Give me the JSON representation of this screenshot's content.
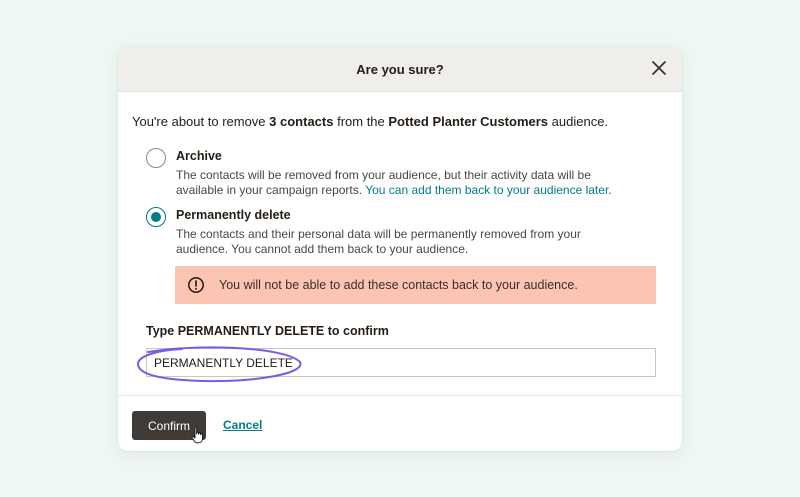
{
  "modal": {
    "title": "Are you sure?",
    "close_icon": "close-icon"
  },
  "intro": {
    "prefix": "You're about to remove ",
    "count": "3 contacts",
    "middle": " from the ",
    "audience": "Potted Planter Customers",
    "suffix": " audience."
  },
  "options": {
    "archive": {
      "title": "Archive",
      "desc_line1": "The contacts will be removed from your audience, but their activity data will be",
      "desc_line2_prefix": "available in your campaign reports. ",
      "desc_line2_link": "You can add them back to your audience later",
      "desc_line2_suffix": ".",
      "selected": false
    },
    "permanent": {
      "title": "Permanently delete",
      "desc_line1": "The contacts and their personal data will be permanently removed from your",
      "desc_line2": "audience. You cannot add them back to your audience.",
      "selected": true
    }
  },
  "warning": {
    "icon": "warning-circle-icon",
    "text": "You will not be able to add these contacts back to your audience."
  },
  "confirm_field": {
    "label": "Type PERMANENTLY DELETE to confirm",
    "value": "PERMANENTLY DELETE"
  },
  "footer": {
    "confirm_label": "Confirm",
    "cancel_label": "Cancel"
  },
  "colors": {
    "background": "#eef7f3",
    "header": "#efeeea",
    "accent": "#007c89",
    "warning_bg": "#fcc5b3",
    "confirm_button": "#403b36",
    "highlight": "#7b5ce0"
  }
}
